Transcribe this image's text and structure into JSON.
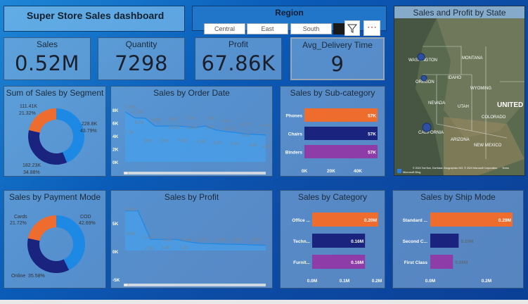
{
  "title": "Super Store Sales dashboard",
  "region": {
    "title": "Region",
    "options": [
      "Central",
      "East",
      "South"
    ]
  },
  "kpis": [
    {
      "label": "Sales",
      "value": "0.52M"
    },
    {
      "label": "Quantity",
      "value": "7298"
    },
    {
      "label": "Profit",
      "value": "67.86K"
    },
    {
      "label": "Avg_Delivery Time",
      "value": "9"
    }
  ],
  "map": {
    "title": "Sales and Profit by State",
    "labels": [
      "WASHINGTON",
      "MONTANA",
      "OREGON",
      "IDAHO",
      "WYOMING",
      "NEVADA",
      "UTAH",
      "COLORADO",
      "CALIFORNIA",
      "ARIZONA",
      "NEW MEXICO",
      "UNITED"
    ],
    "attribution": "© 2024 TomTom, Earthstar Geographics SIO, © 2024 Microsoft Corporation",
    "terms": "Terms",
    "logo": "Microsoft Bing"
  },
  "colors": {
    "blue": "#1e88e5",
    "navy": "#1a237e",
    "orange": "#ef6c2f",
    "purple": "#8e3ca8",
    "area": "#42a5f5"
  },
  "chart_data": [
    {
      "id": "segment",
      "type": "pie",
      "title": "Sum of Sales by Segment",
      "labels": [
        "",
        "",
        ""
      ],
      "values": [
        228.8,
        182.23,
        111.41
      ],
      "percents": [
        "43.79%",
        "34.88%",
        "21.32%"
      ],
      "value_labels": [
        "228.8K",
        "182.23K",
        "111.41K"
      ],
      "colors": [
        "#1e88e5",
        "#1a237e",
        "#ef6c2f"
      ]
    },
    {
      "id": "order_date",
      "type": "area",
      "title": "Sales by Order Date",
      "ylim": [
        0,
        8
      ],
      "yticks": [
        "8K",
        "6K",
        "4K",
        "2K",
        "0K"
      ],
      "series": [
        {
          "values": [
            7.66,
            6.73,
            6.7,
            5.48,
            5.5,
            5.55,
            5.4,
            5.29,
            5.5,
            4.9,
            4.67,
            4.5,
            4.27,
            4.2,
            4.11
          ]
        },
        {
          "values": [
            7.7,
            5.6,
            5.5,
            5.5,
            5.3,
            5.0,
            4.9,
            4.5,
            4.2
          ]
        }
      ],
      "labels": [
        "7.66K",
        "6.73K",
        "6.7K",
        "5.48K",
        "5.5K",
        "5.55K",
        "5.4K",
        "5.29K",
        "5.5K",
        "4.9K",
        "4.67K",
        "4.5K",
        "4.27K",
        "4.2K",
        "4.11K",
        "7.7K",
        "5.6K",
        "5.5K",
        "5.5K",
        "5.3K",
        "5.0K",
        "4.9K",
        "4.5K",
        "4.2K"
      ]
    },
    {
      "id": "subcategory",
      "type": "bar",
      "title": "Sales by Sub-category",
      "categories": [
        "Phones",
        "Chairs",
        "Binders"
      ],
      "values": [
        57,
        57,
        57
      ],
      "value_labels": [
        "57K",
        "57K",
        "57K"
      ],
      "colors": [
        "#ef6c2f",
        "#1a237e",
        "#8e3ca8"
      ],
      "xticks": [
        "0K",
        "20K",
        "40K"
      ],
      "xlim": [
        0,
        57
      ]
    },
    {
      "id": "payment",
      "type": "pie",
      "title": "Sales by Payment Mode",
      "labels": [
        "COD",
        "Online",
        "Cards"
      ],
      "values": [
        42.69,
        35.58,
        21.72
      ],
      "percents": [
        "42.69%",
        "35.58%",
        "21.72%"
      ],
      "colors": [
        "#1e88e5",
        "#1a237e",
        "#ef6c2f"
      ]
    },
    {
      "id": "profit",
      "type": "area",
      "title": "Sales by Profit",
      "yticks": [
        "5K",
        "0K",
        "-5K"
      ],
      "values": [
        6.82,
        6.8,
        1.9,
        1.91,
        1.9,
        1.46,
        1.2,
        1.16,
        1.07,
        1.06,
        0.95,
        0.9
      ],
      "labels": [
        "6.82K",
        "6.8K",
        "1.9K",
        "1.91K",
        "1.9K",
        "1.46K",
        "1.2K",
        "1.16K",
        "1.07K",
        "1.06K",
        "0.95K",
        "0.90K"
      ]
    },
    {
      "id": "category",
      "type": "bar",
      "title": "Sales by Category",
      "categories": [
        "Office ...",
        "Techn...",
        "Furnit..."
      ],
      "values": [
        0.2,
        0.16,
        0.16
      ],
      "value_labels": [
        "0.20M",
        "0.16M",
        "0.16M"
      ],
      "colors": [
        "#ef6c2f",
        "#1a237e",
        "#8e3ca8"
      ],
      "xticks": [
        "0.0M",
        "0.1M",
        "0.2M"
      ],
      "xlim": [
        0,
        0.2
      ]
    },
    {
      "id": "shipmode",
      "type": "bar",
      "title": "Sales by Ship Mode",
      "categories": [
        "Standard ...",
        "Second C...",
        "First Class"
      ],
      "values": [
        0.29,
        0.1,
        0.08
      ],
      "value_labels": [
        "0.29M",
        "0.10M",
        "0.08M"
      ],
      "colors": [
        "#ef6c2f",
        "#1a237e",
        "#8e3ca8"
      ],
      "xticks": [
        "0.0M",
        "0.2M"
      ],
      "xlim": [
        0,
        0.29
      ]
    }
  ]
}
